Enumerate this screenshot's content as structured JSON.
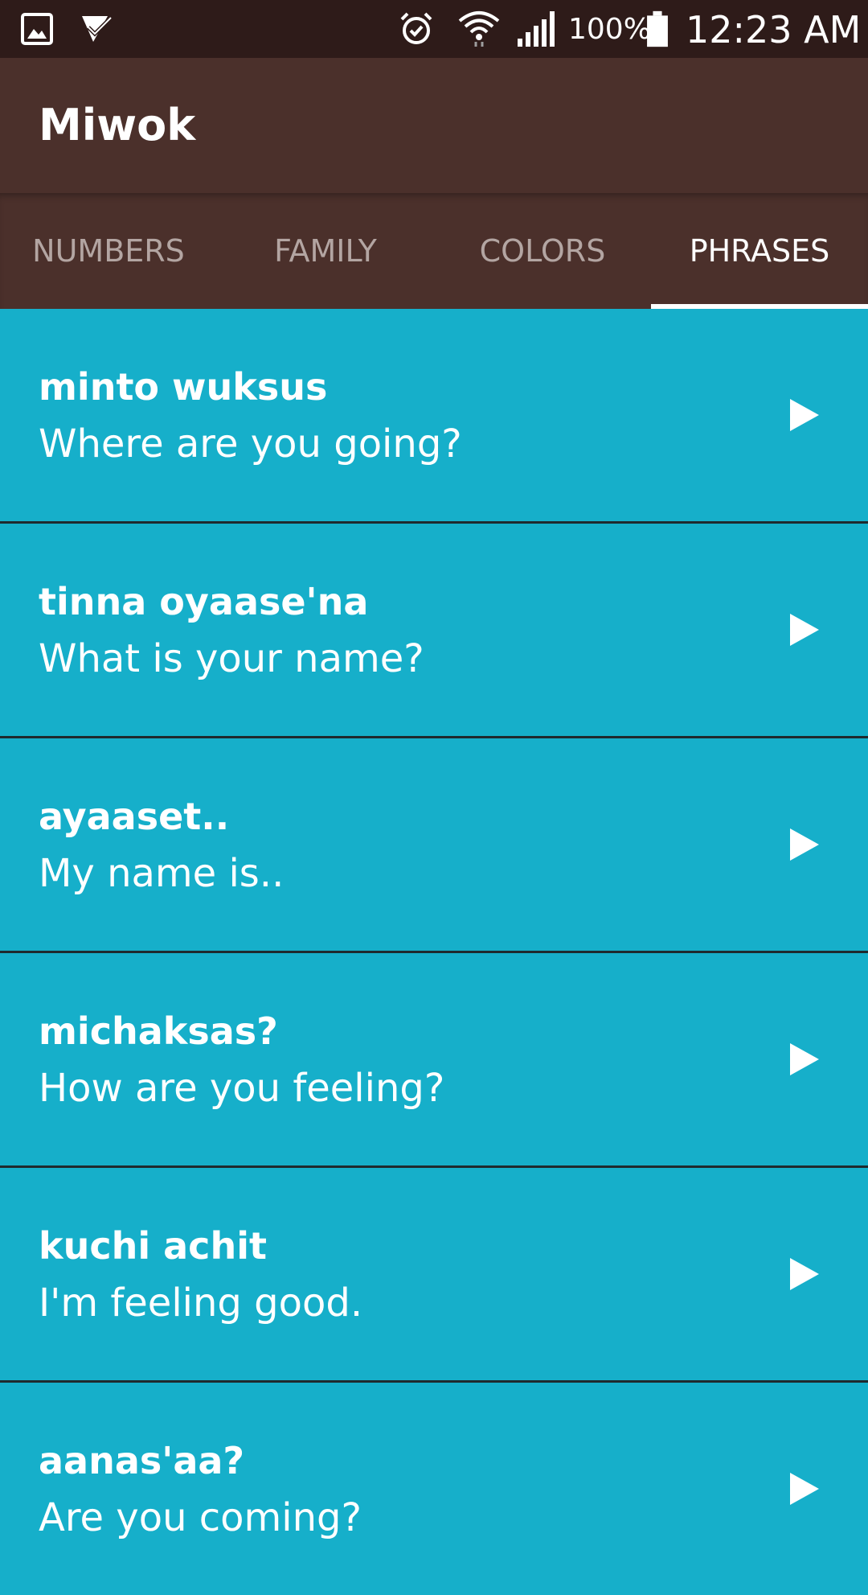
{
  "status_bar": {
    "battery_percent": "100%",
    "time": "12:23 AM",
    "icons": [
      "gallery-icon",
      "task-check-icon",
      "alarm-icon",
      "wifi-icon",
      "signal-icon",
      "battery-icon"
    ]
  },
  "app_bar": {
    "title": "Miwok"
  },
  "tabs": [
    {
      "label": "NUMBERS",
      "active": false
    },
    {
      "label": "FAMILY",
      "active": false
    },
    {
      "label": "COLORS",
      "active": false
    },
    {
      "label": "PHRASES",
      "active": true
    }
  ],
  "phrases": [
    {
      "miwok": "minto wuksus",
      "english": "Where are you going?"
    },
    {
      "miwok": "tinna oyaase'na",
      "english": "What is your name?"
    },
    {
      "miwok": "ayaaset..",
      "english": "My name is.."
    },
    {
      "miwok": "michaksas?",
      "english": "How are you feeling?"
    },
    {
      "miwok": "kuchi achit",
      "english": "I'm feeling good."
    },
    {
      "miwok": "aanas'aa?",
      "english": "Are you coming?"
    }
  ],
  "colors": {
    "status_bar_bg": "#2E1B19",
    "primary": "#4B302B",
    "list_bg": "#16AFCA",
    "tab_inactive": "#B3A5A2",
    "text": "#FFFFFF"
  }
}
